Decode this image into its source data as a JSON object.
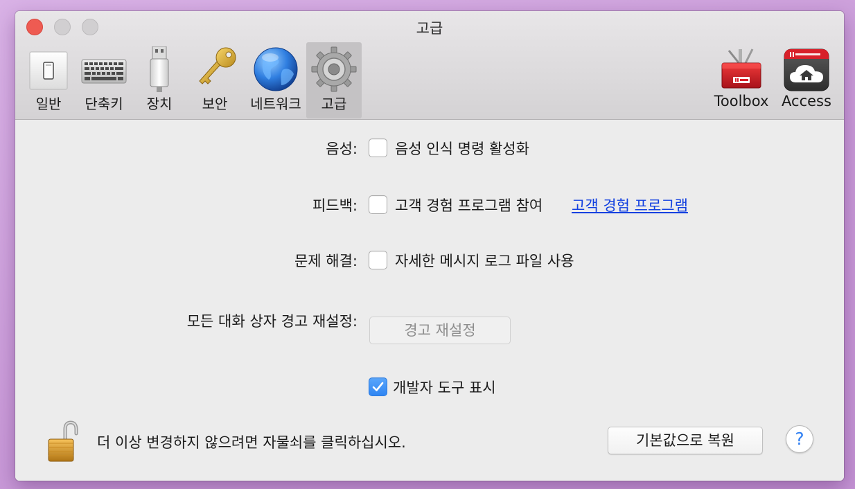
{
  "window": {
    "title": "고급"
  },
  "toolbar": {
    "items": [
      {
        "label": "일반",
        "icon": "switch-icon"
      },
      {
        "label": "단축키",
        "icon": "keyboard-icon"
      },
      {
        "label": "장치",
        "icon": "usb-icon"
      },
      {
        "label": "보안",
        "icon": "key-icon"
      },
      {
        "label": "네트워크",
        "icon": "globe-icon"
      },
      {
        "label": "고급",
        "icon": "gear-icon",
        "selected": true
      }
    ],
    "right_items": [
      {
        "label": "Toolbox",
        "icon": "toolbox-icon",
        "brand": "Parallels"
      },
      {
        "label": "Access",
        "icon": "cloud-home-icon",
        "brand": "Parallels"
      }
    ]
  },
  "settings": {
    "voice": {
      "label": "음성:",
      "option": "음성 인식 명령 활성화",
      "checked": false
    },
    "feedback": {
      "label": "피드백:",
      "option": "고객 경험 프로그램 참여",
      "link": "고객 경험 프로그램",
      "checked": false
    },
    "troubleshoot": {
      "label": "문제 해결:",
      "option": "자세한 메시지 로그 파일 사용",
      "checked": false
    },
    "dialogs": {
      "label": "모든 대화 상자 경고 재설정:",
      "button": "경고 재설정"
    },
    "devtools": {
      "option": "개발자 도구 표시",
      "checked": true
    }
  },
  "footer": {
    "lock_text": "더 이상 변경하지 않으려면 자물쇠를 클릭하십시오.",
    "restore_button": "기본값으로 복원",
    "help": "?"
  },
  "colors": {
    "accent": "#2f85f2",
    "link": "#1240e0",
    "close": "#ee5b52",
    "toolbox_red": "#d8202a"
  }
}
